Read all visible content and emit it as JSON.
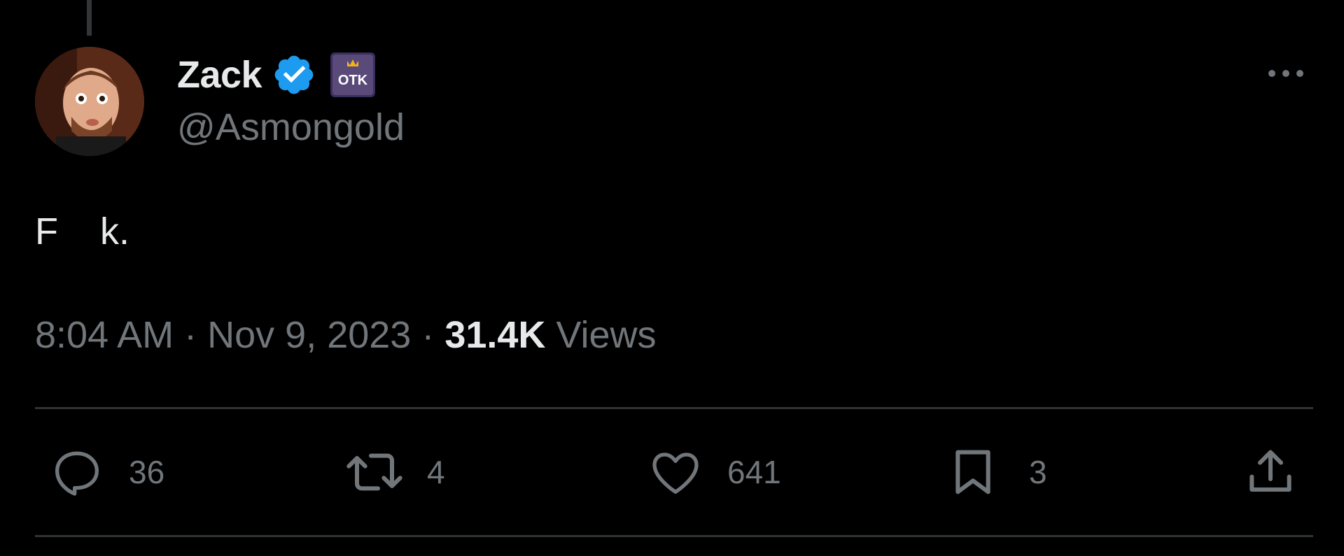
{
  "author": {
    "display_name": "Zack",
    "handle": "@Asmongold",
    "verified_color": "#1d9bf0",
    "affiliate_badge": "OTK"
  },
  "tweet": {
    "text": "F    k.",
    "time": "8:04 AM",
    "date": "Nov 9, 2023",
    "views_count": "31.4K",
    "views_label": "Views",
    "separator": " · "
  },
  "actions": {
    "replies": "36",
    "retweets": "4",
    "likes": "641",
    "bookmarks": "3"
  },
  "icons": {
    "more": "more-horizontal-icon",
    "reply": "reply-icon",
    "retweet": "retweet-icon",
    "like": "heart-icon",
    "bookmark": "bookmark-icon",
    "share": "share-icon"
  },
  "colors": {
    "background": "#000000",
    "text_primary": "#e7e9ea",
    "text_secondary": "#71767b",
    "divider": "#2f3336"
  }
}
